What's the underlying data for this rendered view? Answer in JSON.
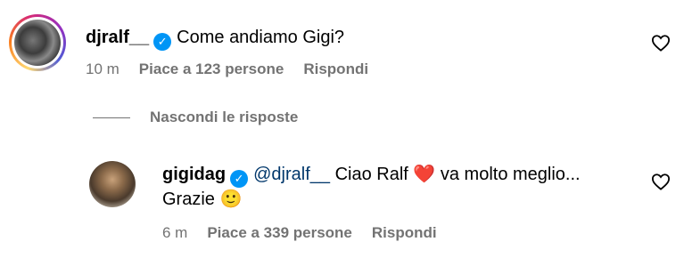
{
  "comment": {
    "username": "djralf__",
    "text": "Come andiamo Gigi?",
    "time": "10 m",
    "likes": "Piace a 123 persone",
    "reply": "Rispondi"
  },
  "toggle_replies": "Nascondi le risposte",
  "reply_comment": {
    "username": "gigidag",
    "mention": "@djralf__",
    "text_before_heart": "Ciao Ralf",
    "heart": "❤️",
    "text_after_heart": "va molto meglio...",
    "text_line2": "Grazie",
    "emoji": "🙂",
    "time": "6 m",
    "likes": "Piace a 339 persone",
    "reply": "Rispondi"
  },
  "icons": {
    "verified": "verified-badge-icon",
    "like": "heart-outline-icon"
  },
  "colors": {
    "verified": "#0095f6",
    "mention": "#00376b",
    "meta": "#737373"
  }
}
